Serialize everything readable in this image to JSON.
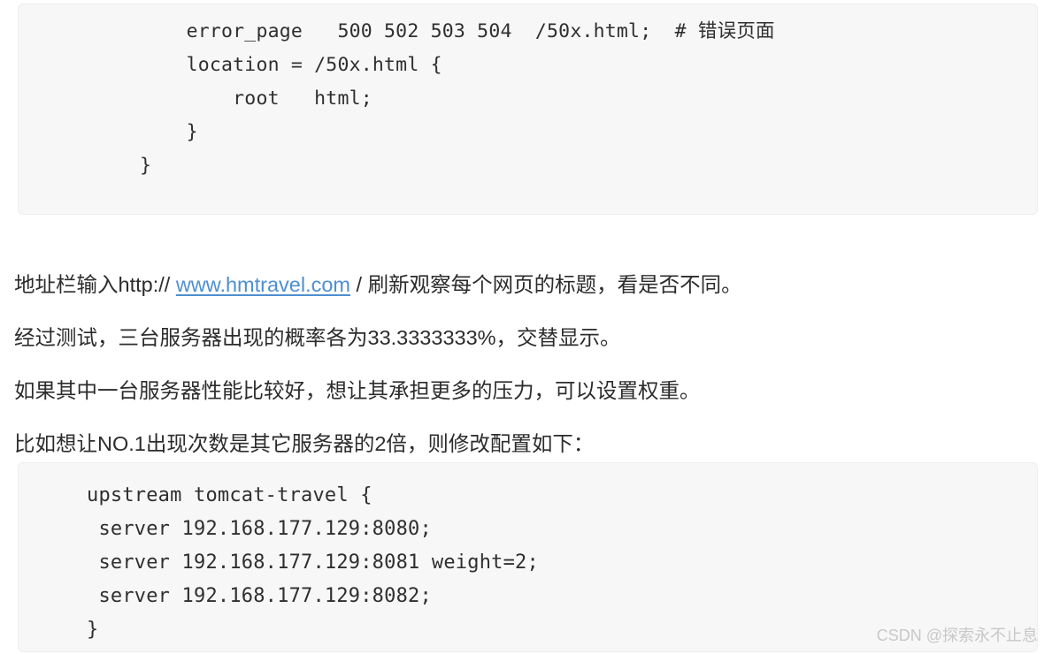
{
  "code_block_1": {
    "name": "nginx-error-page-config",
    "lines": [
      "    error_page   500 502 503 504  /50x.html;  # 错误页面",
      "    location = /50x.html {",
      "        root   html;",
      "    }",
      "}"
    ]
  },
  "paragraphs": {
    "p1": {
      "prefix": "地址栏输入http:// ",
      "link": "www.hmtravel.com",
      "suffix": " / 刷新观察每个网页的标题，看是否不同。"
    },
    "p2": "经过测试，三台服务器出现的概率各为33.3333333%，交替显示。",
    "p3": "如果其中一台服务器性能比较好，想让其承担更多的压力，可以设置权重。",
    "p4": "比如想让NO.1出现次数是其它服务器的2倍，则修改配置如下："
  },
  "code_block_2": {
    "name": "nginx-upstream-weight-config",
    "lines": [
      "upstream tomcat-travel {",
      " server 192.168.177.129:8080;",
      " server 192.168.177.129:8081 weight=2;",
      " server 192.168.177.129:8082;",
      "}"
    ]
  },
  "watermark": {
    "text": "CSDN @探索永不止息"
  },
  "colors": {
    "link": "#4e8fd0",
    "code_background": "#f7f7f8",
    "code_border": "#eceef0",
    "body_text": "#2c2c2c",
    "watermark": "#c8c8c8"
  }
}
